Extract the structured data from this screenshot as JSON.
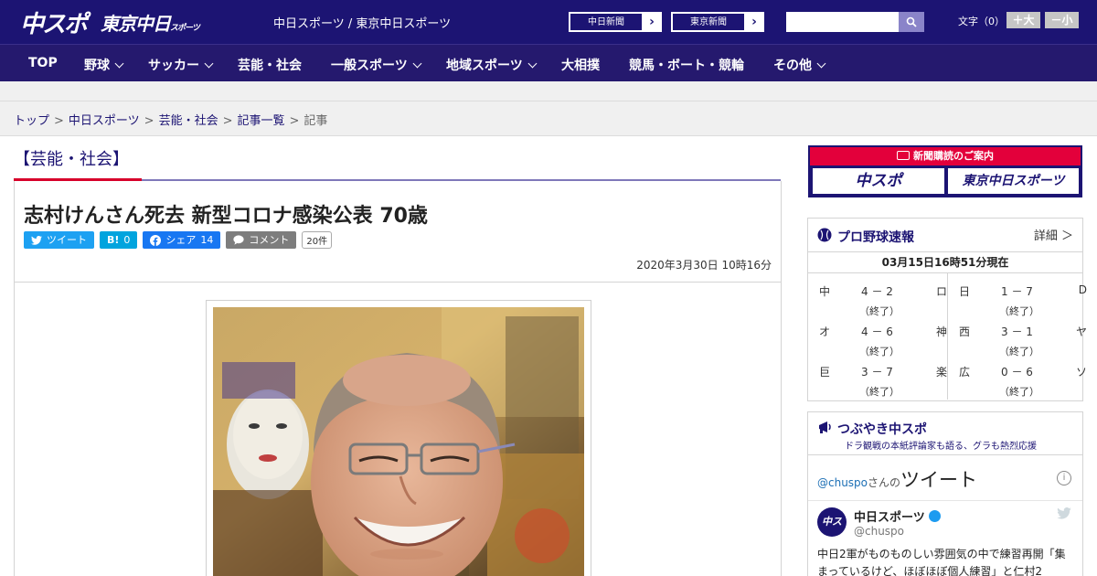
{
  "header": {
    "logo_chuspo": "中スポ",
    "logo_tokyo": "東京中日",
    "logo_tokyo_small": "スポーツ",
    "site_links": "中日スポーツ / 東京中日スポーツ",
    "ext_links": [
      "中日新聞",
      "東京新聞"
    ],
    "search_placeholder": "",
    "fontsize_label": "文字（0）",
    "fontsize_plus": "＋大",
    "fontsize_minus": "－小"
  },
  "nav": {
    "items": [
      {
        "label": "TOP",
        "dropdown": false
      },
      {
        "label": "野球",
        "dropdown": true
      },
      {
        "label": "サッカー",
        "dropdown": true
      },
      {
        "label": "芸能・社会",
        "dropdown": false
      },
      {
        "label": "一般スポーツ",
        "dropdown": true
      },
      {
        "label": "地域スポーツ",
        "dropdown": true
      },
      {
        "label": "大相撲",
        "dropdown": false
      },
      {
        "label": "競馬・ボート・競輪",
        "dropdown": false
      },
      {
        "label": "その他",
        "dropdown": true
      }
    ]
  },
  "breadcrumb": [
    "トップ",
    "中日スポーツ",
    "芸能・社会",
    "記事一覧",
    "記事"
  ],
  "category_title": "【芸能・社会】",
  "article": {
    "headline": "志村けんさん死去 新型コロナ感染公表 70歳",
    "tweet_label": "ツイート",
    "hatena_label": "B!",
    "hatena_count": "0",
    "facebook_label": "シェア",
    "facebook_count": "14",
    "comment_label": "コメント",
    "comment_count": "20件",
    "date": "2020年3月30日 10時16分"
  },
  "sidebar": {
    "subscribe_banner": "新聞購読のご案内",
    "subscribe_logos": [
      "中スポ",
      "東京中日スポーツ"
    ],
    "baseball": {
      "title": "プロ野球速報",
      "more": "詳細 ＞",
      "timestamp": "03月15日16時51分現在",
      "games": [
        {
          "home": "中",
          "score": "4 － 2",
          "away": "ロ",
          "status": "（終了）"
        },
        {
          "home": "日",
          "score": "1 － 7",
          "away": "D",
          "status": "（終了）"
        },
        {
          "home": "オ",
          "score": "4 － 6",
          "away": "神",
          "status": "（終了）"
        },
        {
          "home": "西",
          "score": "3 － 1",
          "away": "ヤ",
          "status": "（終了）"
        },
        {
          "home": "巨",
          "score": "3 － 7",
          "away": "楽",
          "status": "（終了）"
        },
        {
          "home": "広",
          "score": "0 － 6",
          "away": "ソ",
          "status": "（終了）"
        }
      ]
    },
    "twitter": {
      "title": "つぶやき中スポ",
      "subtitle": "ドラ観戦の本紙評論家も語る、グラも熱烈応援",
      "handle_link": "@chuspo",
      "handle_suffix": "さんの",
      "heading": "ツイート",
      "account_name": "中日スポーツ",
      "account_handle": "@chuspo",
      "avatar_text": "中スポ",
      "tweet_text": "中日2軍がものものしい雰囲気の中で練習再開「集まっているけど、ほぼほぼ個人練習」と仁村2"
    }
  },
  "colors": {
    "brand_navy": "#1c1473",
    "nav_bg": "#25196e",
    "accent_red": "#d7002a",
    "twitter_blue": "#1da1f2",
    "hatena_blue": "#00a4de",
    "facebook_blue": "#1877f2"
  }
}
